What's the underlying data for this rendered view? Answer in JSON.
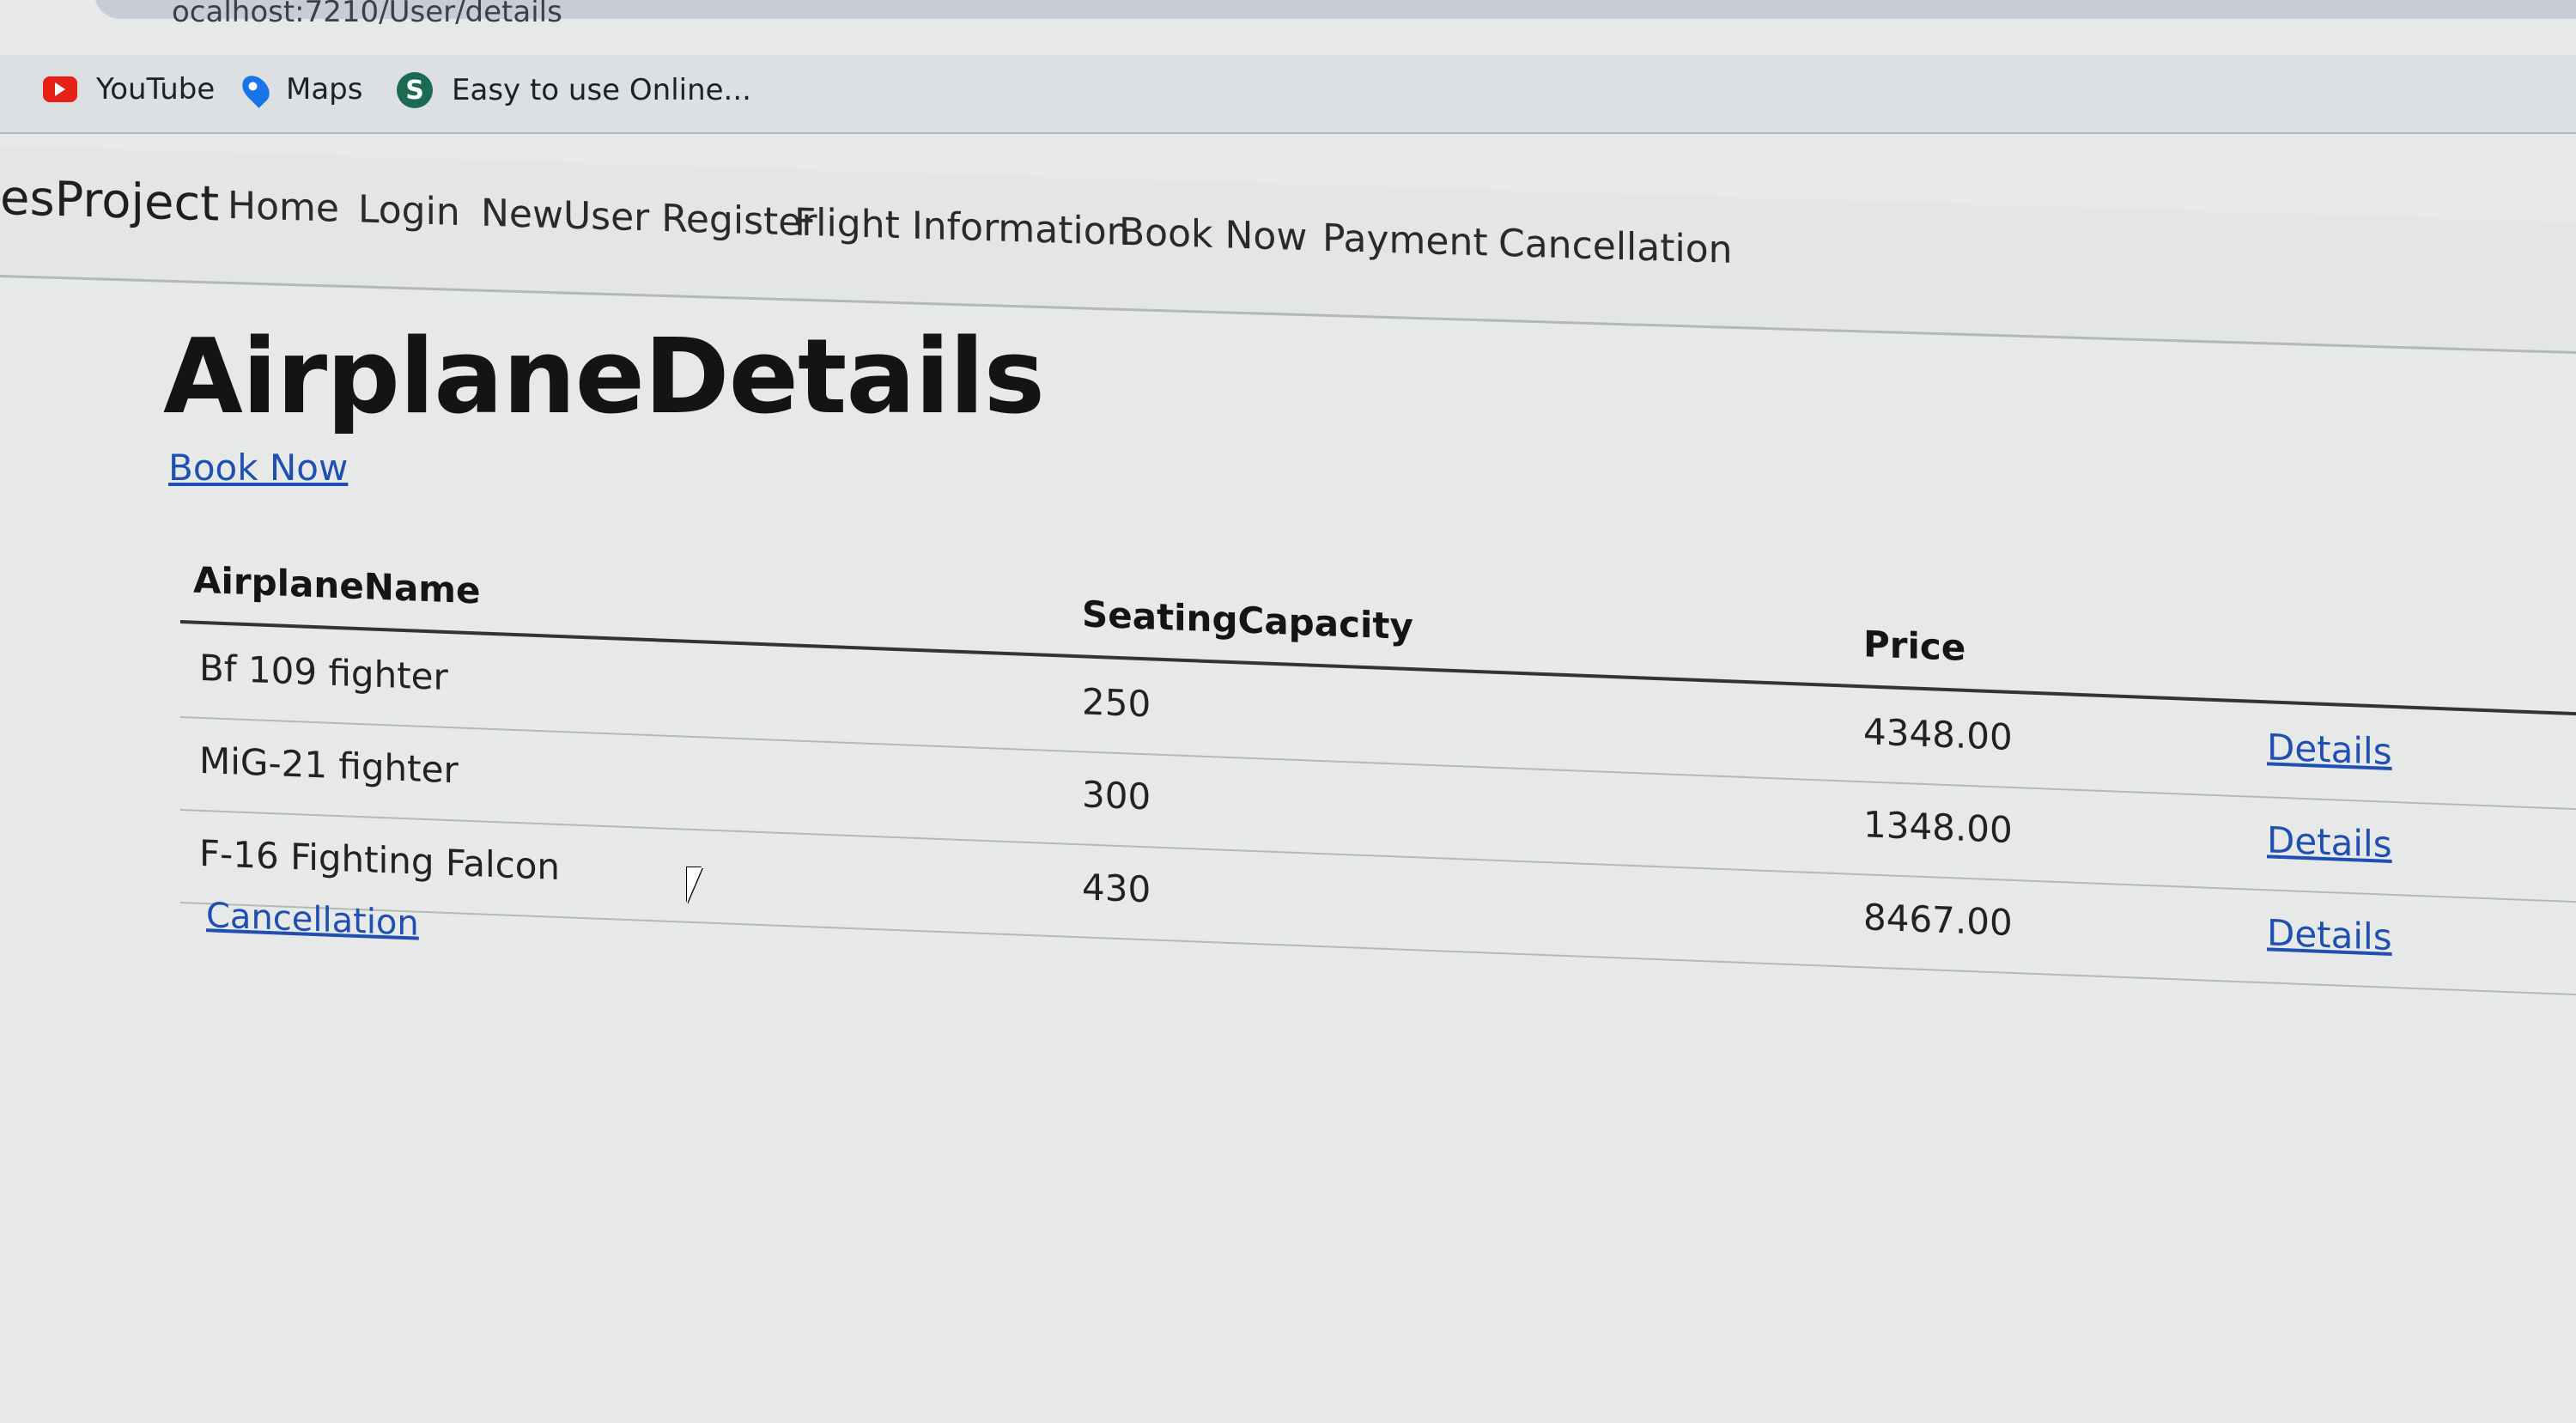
{
  "browser": {
    "url": "ocalhost:7210/User/details",
    "bookmarks": [
      {
        "label": "YouTube",
        "icon": "youtube-icon"
      },
      {
        "label": "Maps",
        "icon": "maps-pin-icon"
      },
      {
        "label": "Easy to use Online...",
        "icon": "s-logo-icon"
      }
    ]
  },
  "navbar": {
    "brand": "esProject",
    "links": [
      "Home",
      "Login",
      "NewUser Register",
      "Flight Information",
      "Book Now",
      "Payment",
      "Cancellation"
    ]
  },
  "main": {
    "title": "AirplaneDetails",
    "book_now_link": "Book Now",
    "table": {
      "headers": [
        "AirplaneName",
        "SeatingCapacity",
        "Price"
      ],
      "rows": [
        {
          "name": "Bf 109 fighter",
          "capacity": "250",
          "price": "4348.00",
          "action": "Details"
        },
        {
          "name": "MiG-21 fighter",
          "capacity": "300",
          "price": "1348.00",
          "action": "Details"
        },
        {
          "name": "F-16 Fighting Falcon",
          "capacity": "430",
          "price": "8467.00",
          "action": "Details"
        }
      ]
    },
    "cancellation_link": "Cancellation"
  },
  "colors": {
    "link": "#1f4fb0",
    "page_bg": "#e6e9e8",
    "youtube_red": "#e62117"
  }
}
